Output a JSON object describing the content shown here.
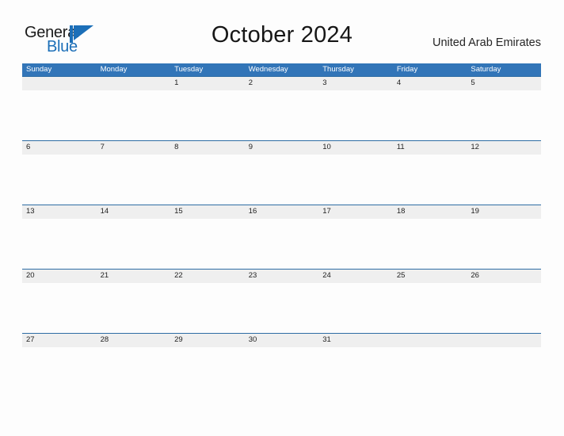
{
  "brand": {
    "name_part1": "General",
    "name_part2": "Blue",
    "flag_icon": "blue-flag-icon",
    "accent_color": "#1c6fb8"
  },
  "header": {
    "title": "October 2024",
    "region": "United Arab Emirates"
  },
  "colors": {
    "header_blue": "#3275b8",
    "row_divider_blue": "#2e6da4",
    "date_band_gray": "#efefef",
    "page_background": "#fdfdfd",
    "text_dark": "#222222",
    "header_text": "#ffffff"
  },
  "calendar": {
    "month": "October",
    "year": "2024",
    "weekday_headers": [
      "Sunday",
      "Monday",
      "Tuesday",
      "Wednesday",
      "Thursday",
      "Friday",
      "Saturday"
    ],
    "weeks": [
      [
        "",
        "",
        "1",
        "2",
        "3",
        "4",
        "5"
      ],
      [
        "6",
        "7",
        "8",
        "9",
        "10",
        "11",
        "12"
      ],
      [
        "13",
        "14",
        "15",
        "16",
        "17",
        "18",
        "19"
      ],
      [
        "20",
        "21",
        "22",
        "23",
        "24",
        "25",
        "26"
      ],
      [
        "27",
        "28",
        "29",
        "30",
        "31",
        "",
        ""
      ]
    ]
  }
}
